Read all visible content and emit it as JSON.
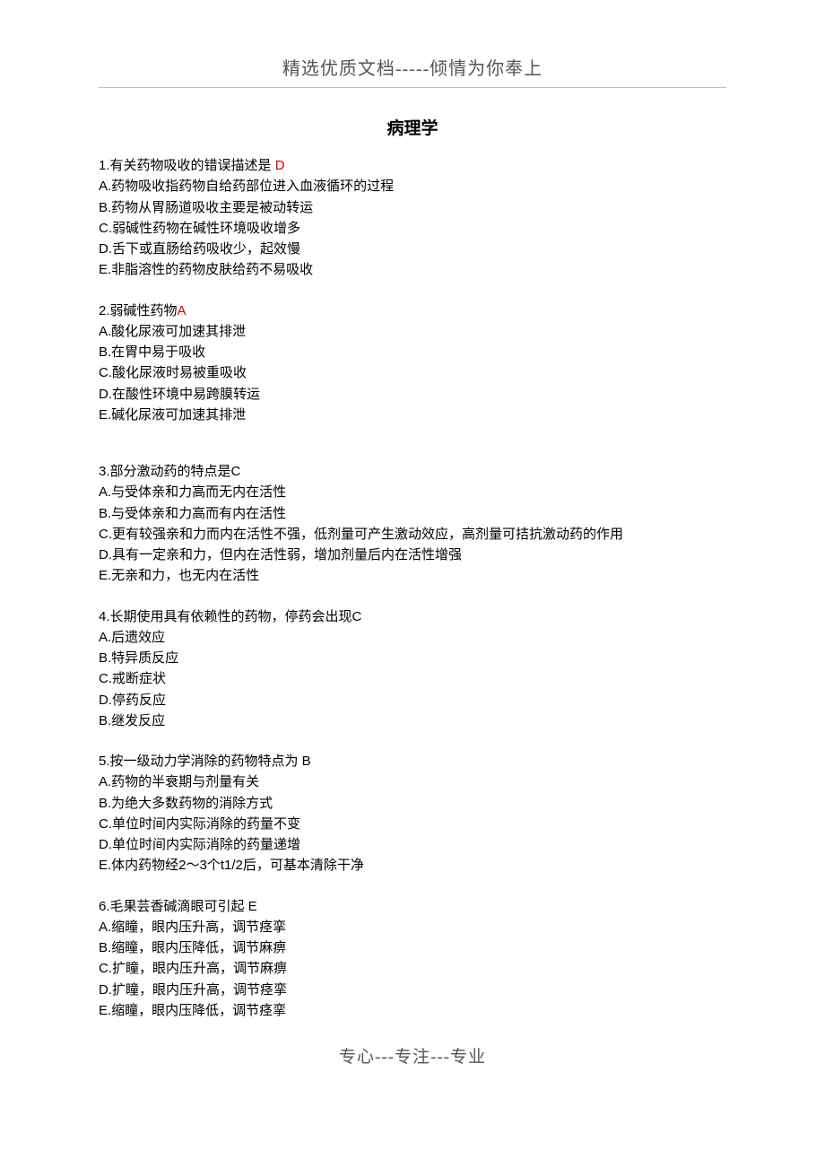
{
  "top_banner": "精选优质文档-----倾情为你奉上",
  "title": "病理学",
  "footer": "专心---专注---专业",
  "questions": [
    {
      "stem_prefix": "1.有关药物吸收的错误描述是   ",
      "answer": "D",
      "options": [
        "A.药物吸收指药物自给药部位进入血液循环的过程",
        "B.药物从胃肠道吸收主要是被动转运",
        "C.弱碱性药物在碱性环境吸收增多",
        "D.舌下或直肠给药吸收少，起效慢",
        "E.非脂溶性的药物皮肤给药不易吸收"
      ]
    },
    {
      "stem_prefix": "2.弱碱性药物",
      "answer": "A",
      "options": [
        "A.酸化尿液可加速其排泄",
        "B.在胃中易于吸收",
        "C.酸化尿液时易被重吸收",
        "D.在酸性环境中易跨膜转运",
        "E.碱化尿液可加速其排泄"
      ]
    },
    {
      "stem_prefix": "3.部分激动药的特点是C",
      "answer": "",
      "options": [
        "A.与受体亲和力高而无内在活性",
        "B.与受体亲和力高而有内在活性",
        "C.更有较强亲和力而内在活性不强，低剂量可产生激动效应，高剂量可拮抗激动药的作用",
        "D.具有一定亲和力，但内在活性弱，增加剂量后内在活性增强",
        "E.无亲和力，也无内在活性"
      ]
    },
    {
      "stem_prefix": "4.长期使用具有依赖性的药物，停药会出现C",
      "answer": "",
      "options": [
        "A.后遗效应",
        "B.特异质反应",
        "C.戒断症状",
        "D.停药反应",
        "B.继发反应"
      ]
    },
    {
      "stem_prefix": "5.按一级动力学消除的药物特点为 B",
      "answer": "",
      "options": [
        "A.药物的半衰期与剂量有关",
        "B.为绝大多数药物的消除方式",
        "C.单位时间内实际消除的药量不变",
        "D.单位时间内实际消除的药量递增",
        "E.体内药物经2～3个t1/2后，可基本清除干净"
      ]
    },
    {
      "stem_prefix": "6.毛果芸香碱滴眼可引起 E",
      "answer": "",
      "options": [
        "A.缩瞳，眼内压升高，调节痉挛",
        "B.缩瞳，眼内压降低，调节麻痹",
        "C.扩瞳，眼内压升高，调节麻痹",
        "D.扩瞳，眼内压升高，调节痉挛",
        "E.缩瞳，眼内压降低，调节痉挛"
      ]
    }
  ]
}
